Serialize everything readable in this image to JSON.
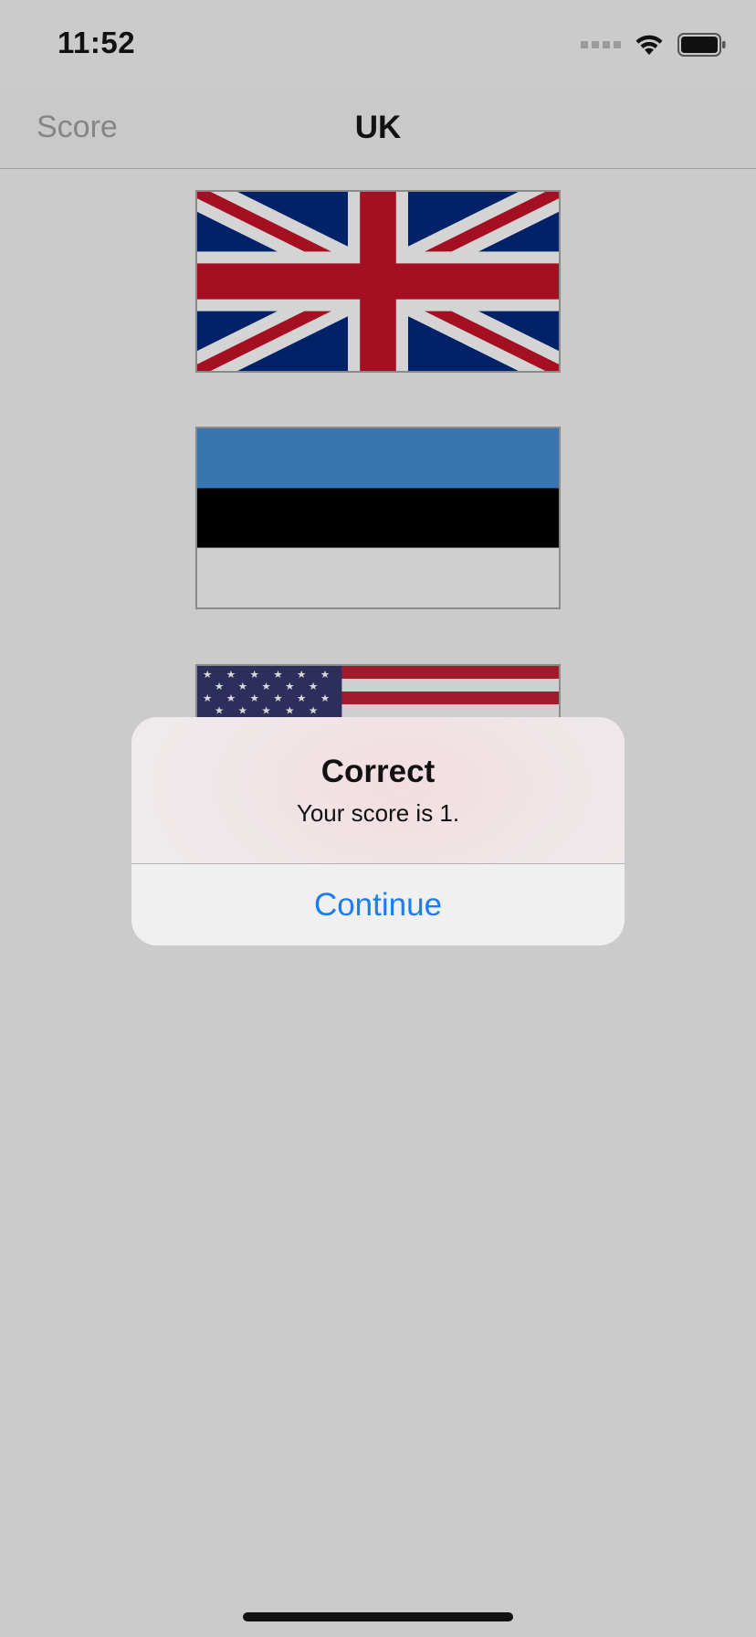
{
  "status_bar": {
    "time": "11:52"
  },
  "nav": {
    "left_label": "Score",
    "title": "UK"
  },
  "flags": [
    {
      "icon": "uk-flag-icon"
    },
    {
      "icon": "estonia-flag-icon"
    },
    {
      "icon": "usa-flag-icon"
    }
  ],
  "alert": {
    "title": "Correct",
    "message": "Your score is 1.",
    "button_label": "Continue"
  },
  "colors": {
    "background": "#cbcbcb",
    "accent": "#1a7ef0"
  }
}
